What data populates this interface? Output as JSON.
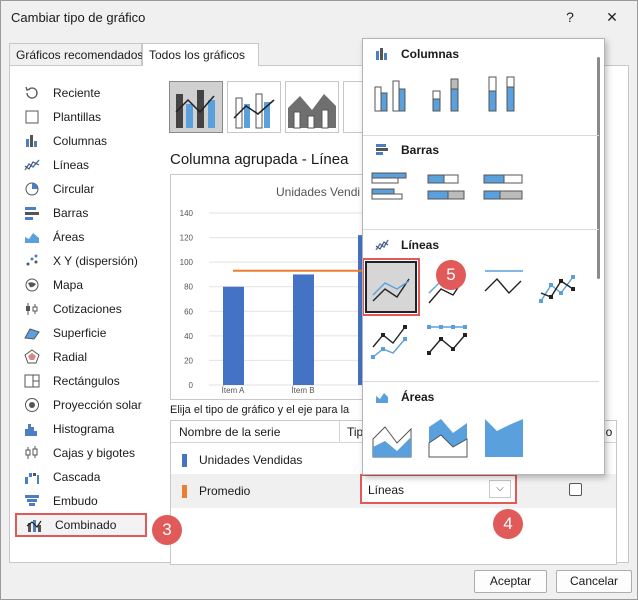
{
  "window": {
    "title": "Cambiar tipo de gráfico",
    "help_label": "?",
    "close_label": "✕"
  },
  "tabs": [
    "Gráficos recomendados",
    "Todos los gráficos"
  ],
  "chart_types": [
    {
      "label": "Reciente",
      "icon": "recent-icon"
    },
    {
      "label": "Plantillas",
      "icon": "templates-icon"
    },
    {
      "label": "Columnas",
      "icon": "column-chart-icon"
    },
    {
      "label": "Líneas",
      "icon": "line-chart-icon"
    },
    {
      "label": "Circular",
      "icon": "pie-chart-icon"
    },
    {
      "label": "Barras",
      "icon": "bar-chart-icon"
    },
    {
      "label": "Áreas",
      "icon": "area-chart-icon"
    },
    {
      "label": "X Y (dispersión)",
      "icon": "scatter-chart-icon"
    },
    {
      "label": "Mapa",
      "icon": "map-chart-icon"
    },
    {
      "label": "Cotizaciones",
      "icon": "stock-chart-icon"
    },
    {
      "label": "Superficie",
      "icon": "surface-chart-icon"
    },
    {
      "label": "Radial",
      "icon": "radar-chart-icon"
    },
    {
      "label": "Rectángulos",
      "icon": "treemap-chart-icon"
    },
    {
      "label": "Proyección solar",
      "icon": "sunburst-chart-icon"
    },
    {
      "label": "Histograma",
      "icon": "histogram-chart-icon"
    },
    {
      "label": "Cajas y bigotes",
      "icon": "box-whisker-chart-icon"
    },
    {
      "label": "Cascada",
      "icon": "waterfall-chart-icon"
    },
    {
      "label": "Embudo",
      "icon": "funnel-chart-icon"
    },
    {
      "label": "Combinado",
      "icon": "combo-chart-icon"
    }
  ],
  "selected_type": "Combinado",
  "chart_subtitle": "Columna agrupada - Línea",
  "preview": {
    "title": "Unidades Vendi",
    "yticks": [
      "140",
      "120",
      "100",
      "80",
      "60",
      "40",
      "20",
      "0"
    ],
    "xticks": [
      "Ítem A",
      "Ítem B",
      "Íte"
    ]
  },
  "chart_data": {
    "type": "bar",
    "categories": [
      "Ítem A",
      "Ítem B"
    ],
    "series": [
      {
        "name": "Unidades Vendidas",
        "values": [
          80,
          90
        ]
      },
      {
        "name": "Promedio",
        "values": [
          93,
          93
        ]
      }
    ],
    "ylim": [
      0,
      140
    ],
    "title": "Unidades Vendi"
  },
  "series_panel": {
    "caption": "Elija el tipo de gráfico y el eje para la",
    "col_name": "Nombre de la serie",
    "col_type": "Tip",
    "col_axis": "rio",
    "rows": [
      {
        "name": "Unidades Vendidas",
        "color": "#4472c4"
      },
      {
        "name": "Promedio",
        "color": "#ed7d31"
      }
    ],
    "promedio_type": "Líneas"
  },
  "popup": {
    "columnas": "Columnas",
    "barras": "Barras",
    "lineas": "Líneas",
    "areas": "Áreas"
  },
  "callouts": [
    "3",
    "4",
    "5"
  ],
  "buttons": {
    "ok": "Aceptar",
    "cancel": "Cancelar"
  },
  "colors": {
    "blue": "#4472c4",
    "orange": "#ed7d31",
    "accent": "#e05a5a"
  }
}
